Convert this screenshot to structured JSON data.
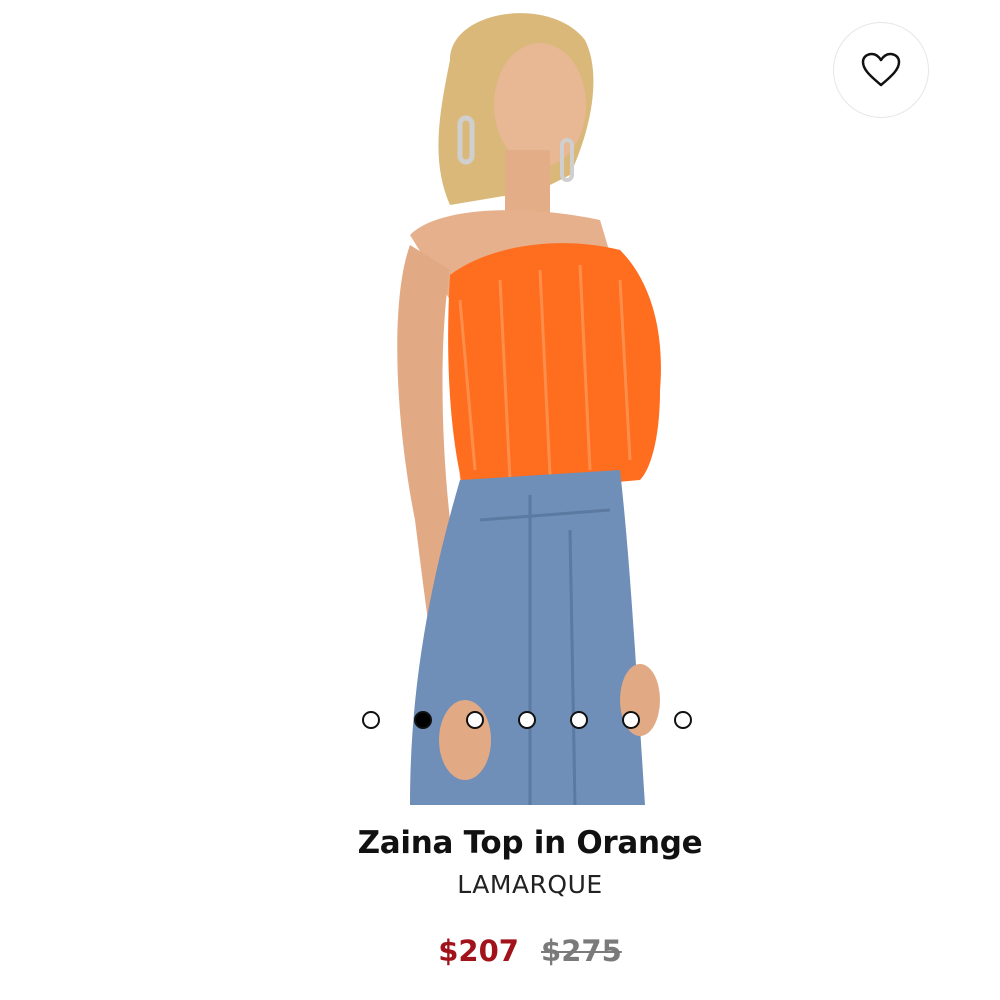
{
  "product": {
    "name": "Zaina Top in Orange",
    "brand": "LAMARQUE",
    "price_sale": "$207",
    "price_original": "$275"
  },
  "wishlist": {
    "icon": "heart-outline-icon"
  },
  "carousel": {
    "total": 7,
    "active_index": 1
  },
  "colors": {
    "sale_price": "#a1121b",
    "original_price": "#7a7a7a",
    "top_orange": "#ff6d1f",
    "denim": "#6f8fb8"
  }
}
